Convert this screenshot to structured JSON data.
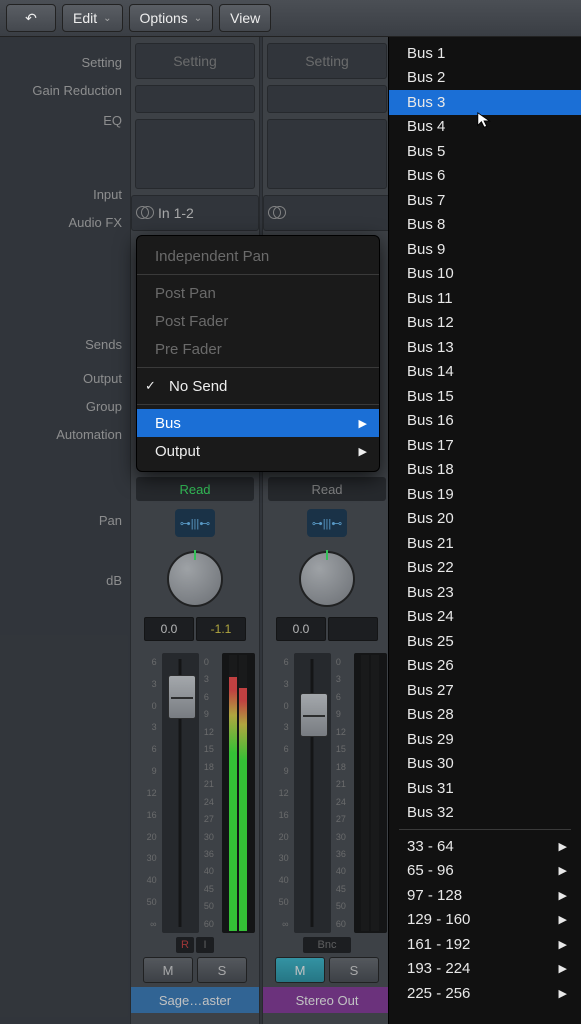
{
  "toolbar": {
    "back_icon": "↶",
    "edit": "Edit",
    "options": "Options",
    "view": "View"
  },
  "labels": {
    "setting": "Setting",
    "gain_reduction": "Gain Reduction",
    "eq": "EQ",
    "input": "Input",
    "audio_fx": "Audio FX",
    "sends": "Sends",
    "output": "Output",
    "group": "Group",
    "automation": "Automation",
    "pan": "Pan",
    "db": "dB"
  },
  "strip1": {
    "setting_label": "Setting",
    "input": "In 1-2",
    "automation": "Read",
    "db_l": "0.0",
    "db_r": "-1.1",
    "r": "R",
    "i": "I",
    "m": "M",
    "s": "S",
    "name": "Sage…aster"
  },
  "strip2": {
    "setting_label": "Setting",
    "automation": "Read",
    "db_l": "0.0",
    "bnc": "Bnc",
    "m": "M",
    "s": "S",
    "name": "Stereo Out"
  },
  "fader_scale_left": [
    "6",
    "3",
    "0",
    "3",
    "6",
    "9",
    "12",
    "16",
    "20",
    "30",
    "40",
    "50",
    "∞"
  ],
  "meter_scale": [
    "0",
    "3",
    "6",
    "9",
    "12",
    "15",
    "18",
    "21",
    "24",
    "27",
    "30",
    "36",
    "40",
    "45",
    "50",
    "60"
  ],
  "context_menu": {
    "independent_pan": "Independent Pan",
    "post_pan": "Post Pan",
    "post_fader": "Post Fader",
    "pre_fader": "Pre Fader",
    "no_send": "No Send",
    "bus": "Bus",
    "output": "Output"
  },
  "bus_list": [
    "Bus 1",
    "Bus 2",
    "Bus 3",
    "Bus 4",
    "Bus 5",
    "Bus 6",
    "Bus 7",
    "Bus 8",
    "Bus 9",
    "Bus 10",
    "Bus 11",
    "Bus 12",
    "Bus 13",
    "Bus 14",
    "Bus 15",
    "Bus 16",
    "Bus 17",
    "Bus 18",
    "Bus 19",
    "Bus 20",
    "Bus 21",
    "Bus 22",
    "Bus 23",
    "Bus 24",
    "Bus 25",
    "Bus 26",
    "Bus 27",
    "Bus 28",
    "Bus 29",
    "Bus 30",
    "Bus 31",
    "Bus 32"
  ],
  "bus_selected_index": 2,
  "bus_ranges": [
    "33 - 64",
    "65 - 96",
    "97 - 128",
    "129 - 160",
    "161 - 192",
    "193 - 224",
    "225 - 256"
  ]
}
